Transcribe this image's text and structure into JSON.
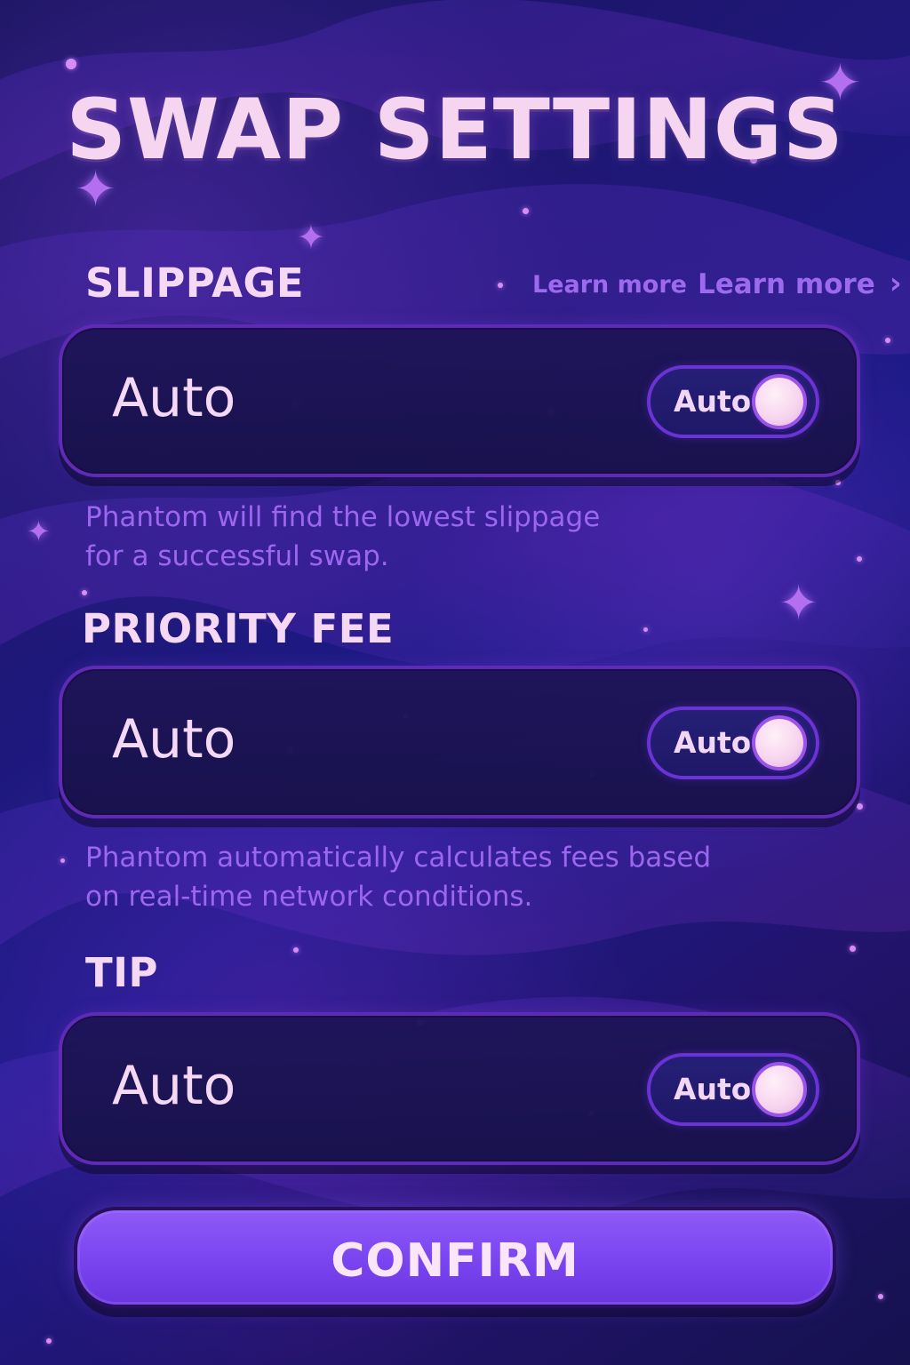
{
  "title": "SWAP SETTINGS",
  "slippage": {
    "label": "SLIPPAGE",
    "learn_more_small": "Learn more",
    "learn_more_large": "Learn more",
    "chevron_icon": "chevron-right-icon",
    "value": "Auto",
    "toggle_label": "Auto",
    "description_line1": "Phantom will find the lowest slippage",
    "description_line2": "for a successful swap."
  },
  "priority_fee": {
    "label": "PRIORITY FEE",
    "value": "Auto",
    "toggle_label": "Auto",
    "description_line1": "Phantom automatically calculates fees based",
    "description_line2": "on real-time network conditions."
  },
  "tip": {
    "label": "TIP",
    "value": "Auto",
    "toggle_label": "Auto"
  },
  "confirm": {
    "label": "CONFIRM"
  },
  "colors": {
    "background_primary": "#1d1b8c",
    "accent_purple": "#7b46f1",
    "text_light": "#f5d8f4",
    "text_muted": "#9c66ef"
  }
}
